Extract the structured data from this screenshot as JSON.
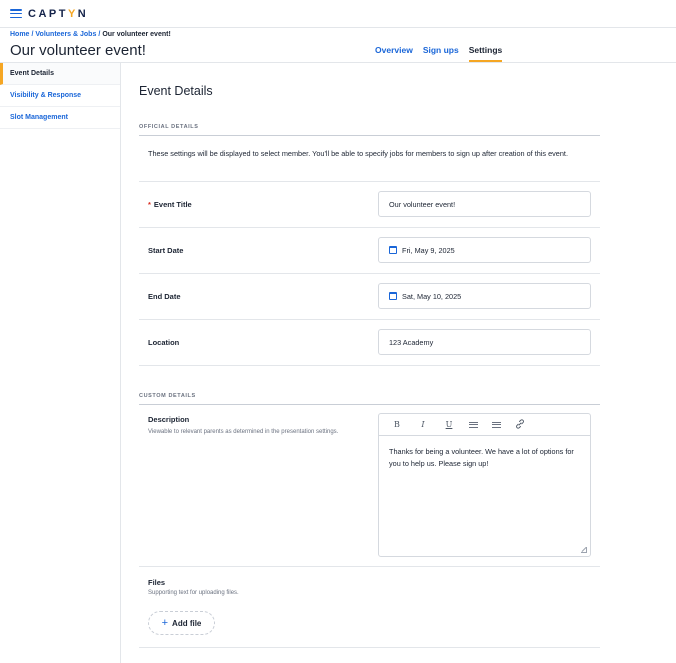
{
  "app": {
    "logo_text": "CAPT",
    "logo_accent": "Y",
    "logo_tail": "N",
    "accent_color": "#f5a623",
    "link_color": "#1a66d8"
  },
  "breadcrumb": {
    "home": "Home",
    "section": "Volunteers & Jobs",
    "current": "Our volunteer event!"
  },
  "page_title": "Our volunteer event!",
  "tabs": [
    {
      "label": "Overview",
      "active": false
    },
    {
      "label": "Sign ups",
      "active": false
    },
    {
      "label": "Settings",
      "active": true
    }
  ],
  "sidebar": {
    "items": [
      {
        "label": "Event Details",
        "active": true
      },
      {
        "label": "Visibility & Response",
        "active": false
      },
      {
        "label": "Slot Management",
        "active": false
      }
    ]
  },
  "main": {
    "section_title": "Event Details",
    "official_label": "OFFICIAL DETAILS",
    "intro": "These settings will be displayed to select member. You'll be able to specify jobs for members to sign up after creation of this event.",
    "fields": {
      "title_label": "Event Title",
      "title_required": "*",
      "title_value": "Our volunteer event!",
      "start_label": "Start Date",
      "start_value": "Fri, May 9, 2025",
      "end_label": "End Date",
      "end_value": "Sat, May 10, 2025",
      "location_label": "Location",
      "location_value": "123 Academy"
    },
    "custom_label": "CUSTOM DETAILS",
    "description": {
      "label": "Description",
      "sublabel": "Viewable to relevant parents as determined in the presentation settings.",
      "toolbar": [
        "B",
        "I",
        "U",
        "bulleted-list-icon",
        "numbered-list-icon",
        "link-icon"
      ],
      "value": "Thanks for being a volunteer. We have a lot of options for you to help us. Please sign up!"
    },
    "files": {
      "label": "Files",
      "sublabel": "Supporting text for uploading files.",
      "add_label": "Add file",
      "add_icon": "+"
    }
  }
}
